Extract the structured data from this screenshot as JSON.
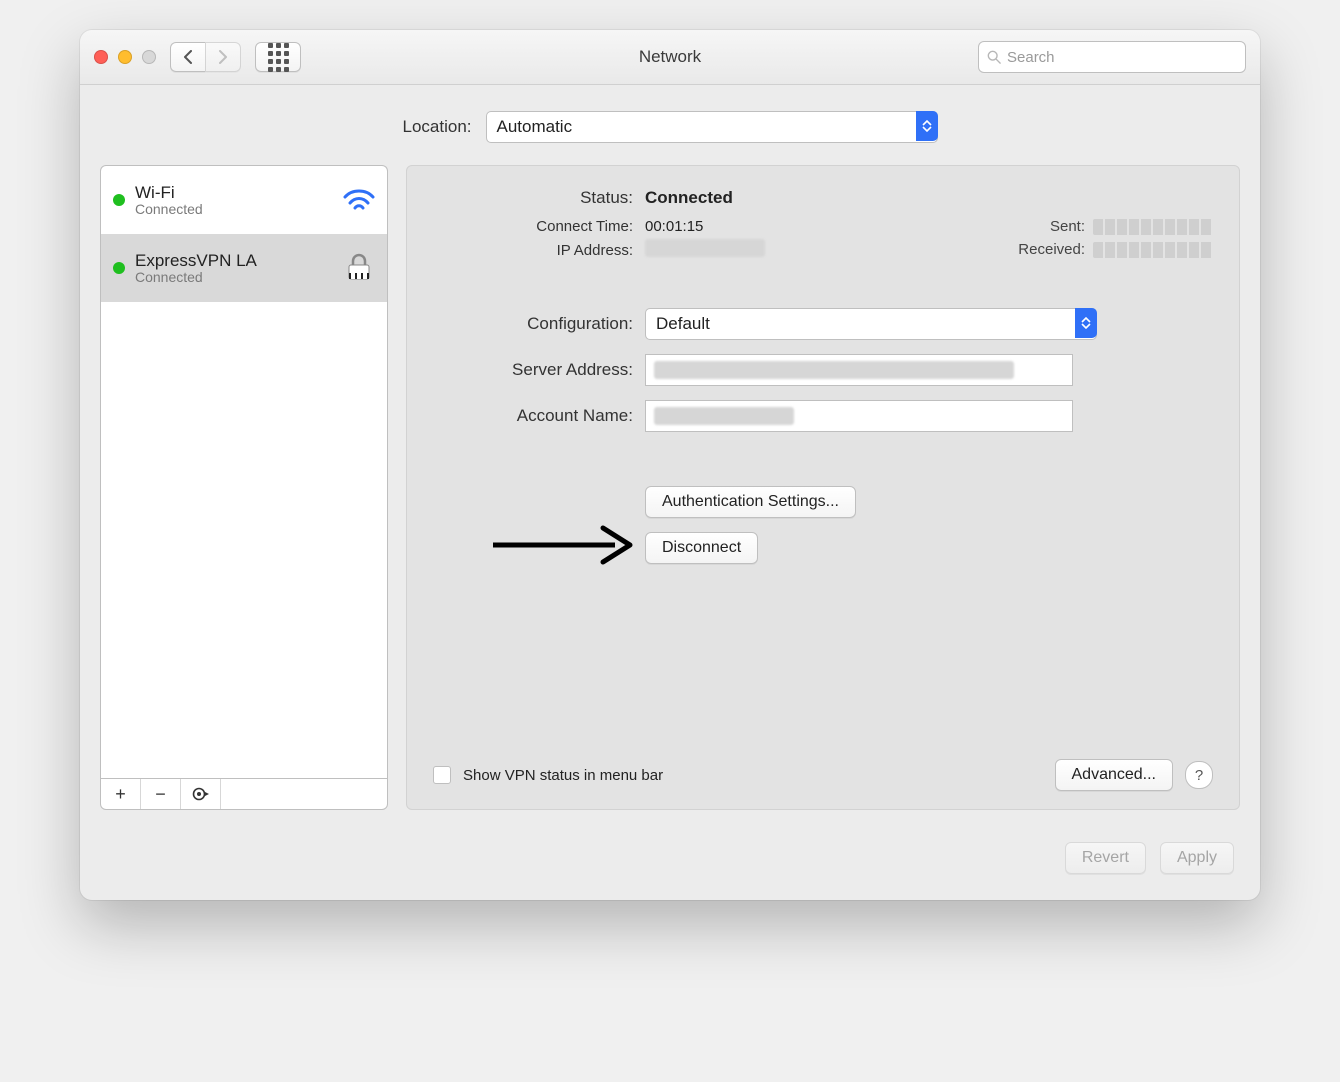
{
  "window": {
    "title": "Network",
    "search_placeholder": "Search"
  },
  "location": {
    "label": "Location:",
    "value": "Automatic"
  },
  "services": [
    {
      "name": "Wi-Fi",
      "status": "Connected",
      "icon": "wifi",
      "selected": false
    },
    {
      "name": "ExpressVPN LA",
      "status": "Connected",
      "icon": "vpn",
      "selected": true
    }
  ],
  "sidebar_actions": {
    "gear": ""
  },
  "detail": {
    "status_label": "Status:",
    "status_value": "Connected",
    "connect_time_label": "Connect Time:",
    "connect_time_value": "00:01:15",
    "ip_label": "IP Address:",
    "sent_label": "Sent:",
    "received_label": "Received:",
    "config_label": "Configuration:",
    "config_value": "Default",
    "server_label": "Server Address:",
    "account_label": "Account Name:",
    "auth_button": "Authentication Settings...",
    "disconnect_button": "Disconnect",
    "show_vpn_label": "Show VPN status in menu bar",
    "advanced_button": "Advanced...",
    "help": "?"
  },
  "footer": {
    "revert": "Revert",
    "apply": "Apply"
  }
}
